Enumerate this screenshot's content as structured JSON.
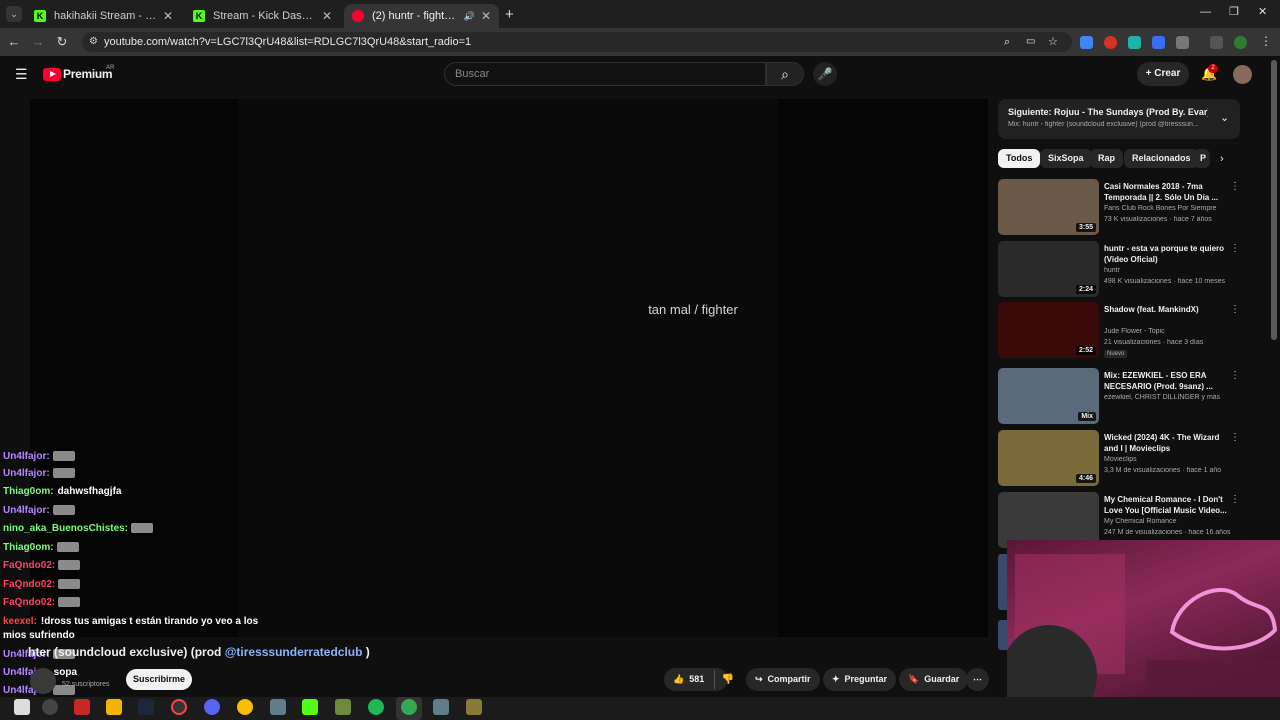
{
  "tabs": [
    {
      "title": "hakihakii Stream - Watch Live o",
      "icon": "kick-icon",
      "color": "#53fc18"
    },
    {
      "title": "Stream - Kick Dashboard",
      "icon": "kick-icon",
      "color": "#53fc18"
    },
    {
      "title": "(2) huntr - fighter (soundcl",
      "icon": "youtube-icon",
      "color": "#ff0033",
      "active": true
    }
  ],
  "browser": {
    "url": "youtube.com/watch?v=LGC7l3QrU48&list=RDLGC7l3QrU48&start_radio=1"
  },
  "header": {
    "brand": "Premium",
    "region": "AR",
    "search_placeholder": "Buscar",
    "create_label": "Crear",
    "notif_count": "2"
  },
  "video": {
    "overlay_text": "tan mal / fighter",
    "title_visible": "hter (soundcloud exclusive) (prod",
    "title_link": "@tiresssunderratedclub",
    "title_close": ")",
    "subs": "52 suscriptores",
    "subscribe_label": "Suscribirme",
    "likes": "581",
    "share_label": "Compartir",
    "ask_label": "Preguntar",
    "save_label": "Guardar"
  },
  "chat": [
    {
      "user": "Un4lfajor:",
      "color": "#b388ff",
      "text": "",
      "emote": true
    },
    {
      "user": "Un4lfajor:",
      "color": "#b388ff",
      "text": "",
      "emote": true
    },
    {
      "user": "Thiag0om:",
      "color": "#7cfc7c",
      "text": "dahwsfhagjfa",
      "emote": false
    },
    {
      "user": "Un4lfajor:",
      "color": "#b388ff",
      "text": "",
      "emote": true
    },
    {
      "user": "nino_aka_BuenosChistes:",
      "color": "#7cfc7c",
      "text": "",
      "emote": true
    },
    {
      "user": "Thiag0om:",
      "color": "#7cfc7c",
      "text": "",
      "emote": true
    },
    {
      "user": "FaQndo02:",
      "color": "#ff4466",
      "text": "",
      "emote": true
    },
    {
      "user": "FaQndo02:",
      "color": "#ff4466",
      "text": "",
      "emote": true
    },
    {
      "user": "FaQndo02:",
      "color": "#ff4466",
      "text": "",
      "emote": true
    },
    {
      "user": "keexel:",
      "color": "#ff4444",
      "text": "!dross tus amigas t están tirando yo veo a los",
      "emote": false
    },
    {
      "user": "",
      "color": "#ffffff",
      "text": "mios sufriendo",
      "emote": false
    },
    {
      "user": "Un4lfajor:",
      "color": "#b388ff",
      "text": "",
      "emote": true
    },
    {
      "user": "Un4lfajor:",
      "color": "#b388ff",
      "text": "sopa",
      "emote": false
    },
    {
      "user": "Un4lfajor:",
      "color": "#b388ff",
      "text": "",
      "emote": true
    },
    {
      "user": "Un4lfajor:",
      "color": "#b388ff",
      "text": "",
      "emote": true
    }
  ],
  "sidebar": {
    "up_next_label": "Siguiente:",
    "up_next_title": "Rojuu - The Sundays (Prod By. Evar) #CIT...",
    "mix_label": "Mix: huntr - fighter (soundcloud exclusive) (prod @tiresssun...",
    "chips": [
      "Todos",
      "SixSopa",
      "Rap",
      "Relacionados",
      "P"
    ],
    "videos": [
      {
        "title": "Casi Normales 2018 - 7ma Temporada || 2. Sólo Un Día ...",
        "channel": "Fans Club Rock Bones Por Siempre",
        "meta": "73 K visualizaciones · hace 7 años",
        "duration": "3:55",
        "thumb": "#6b5a4a"
      },
      {
        "title": "huntr - esta va porque te quiero (Video Oficial)",
        "channel": "huntr",
        "meta": "498 K visualizaciones · hace 10 meses",
        "duration": "2:24",
        "thumb": "#2a2a2a"
      },
      {
        "title": "Shadow (feat. MankindX)",
        "channel": "Jude Flower - Topic",
        "meta": "21 visualizaciones · hace 3 días",
        "duration": "2:52",
        "thumb": "#3a0a0a",
        "badge": "Nuevo"
      },
      {
        "title": "Mix: EZEWKIEL - ESO ERA NECESARIO (Prod. 9sanz) ...",
        "channel": "ezewkiel, CHRIST DILLINGER y más",
        "meta": "",
        "duration": "Mix",
        "thumb": "#5a6a7a"
      },
      {
        "title": "Wicked (2024) 4K - The Wizard and I | Movieclips",
        "channel": "Movieclips",
        "meta": "3,3 M de visualizaciones · hace 1 año",
        "duration": "4:46",
        "thumb": "#7a6a3a"
      },
      {
        "title": "My Chemical Romance - I Don't Love You [Official Music Video...",
        "channel": "My Chemical Romance",
        "meta": "247 M de visualizaciones · hace 16 años",
        "duration": "",
        "thumb": "#3a3a3a"
      }
    ]
  }
}
